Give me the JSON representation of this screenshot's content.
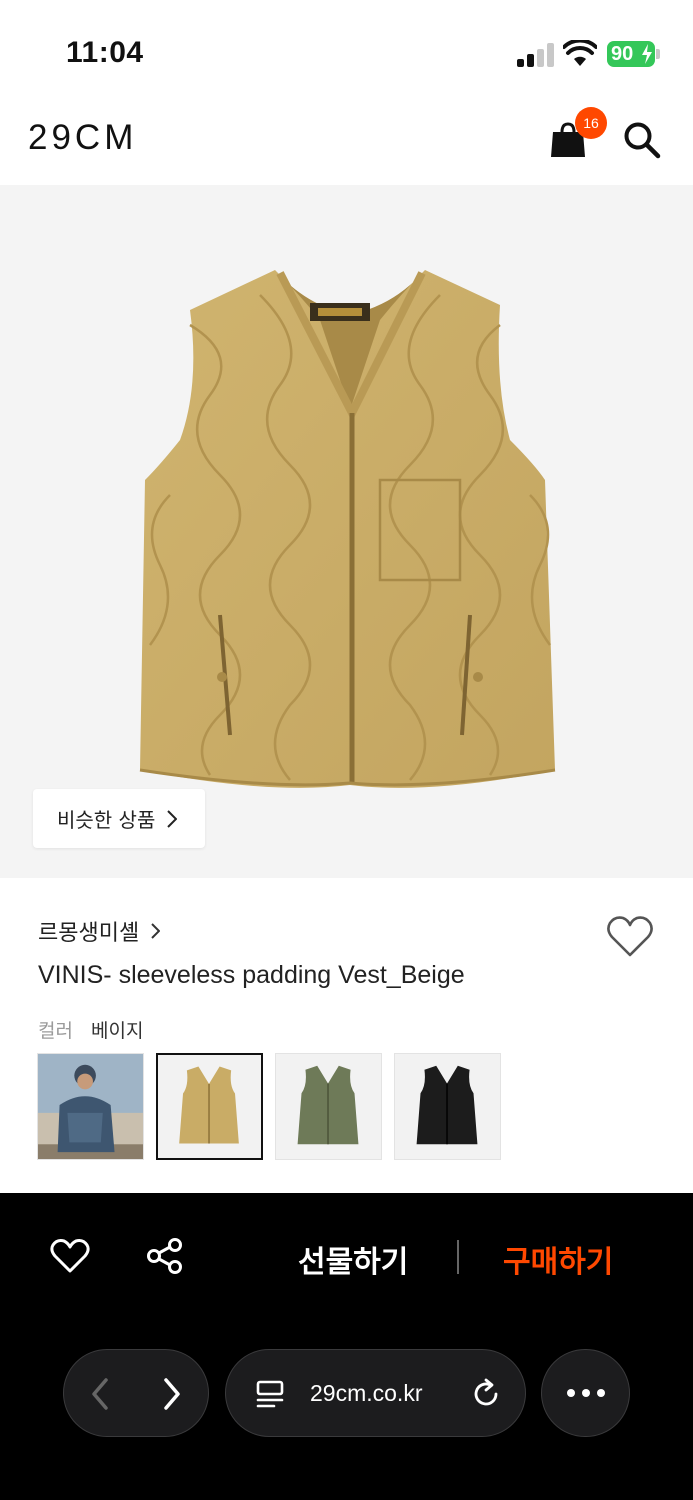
{
  "status_bar": {
    "time": "11:04",
    "battery": "90"
  },
  "header": {
    "logo": "29CM",
    "cart_count": "16"
  },
  "hero": {
    "similar_button": "비슷한 상품"
  },
  "product": {
    "brand": "르몽생미셸",
    "title": "VINIS- sleeveless padding Vest_Beige",
    "color_label": "컬러",
    "color_value": "베이지",
    "thumbnails": [
      {
        "name": "model-photo",
        "selected": false
      },
      {
        "name": "beige",
        "selected": true
      },
      {
        "name": "khaki",
        "selected": false
      },
      {
        "name": "black",
        "selected": false
      }
    ]
  },
  "action_bar": {
    "gift_label": "선물하기",
    "buy_label": "구매하기"
  },
  "browser": {
    "url": "29cm.co.kr"
  },
  "colors": {
    "accent": "#ff4800",
    "vest_beige": "#c9ac66",
    "vest_khaki": "#6e7a58",
    "vest_black": "#1c1c1c",
    "battery_green": "#34c759"
  }
}
